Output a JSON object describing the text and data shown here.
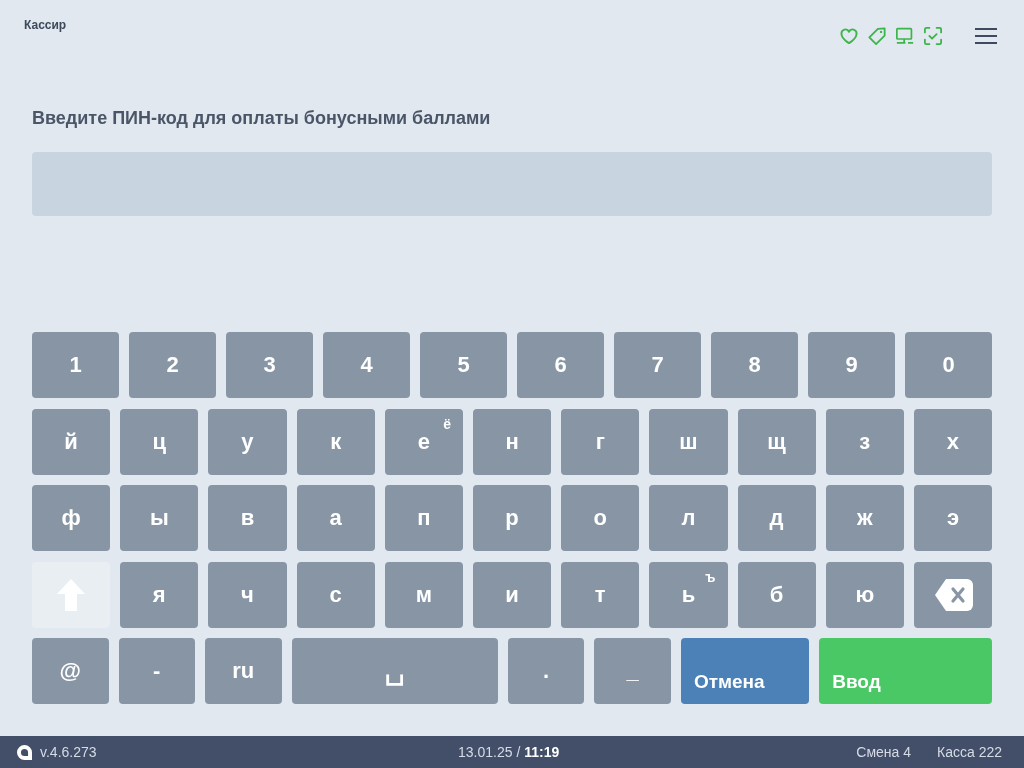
{
  "header": {
    "title": "Кассир"
  },
  "prompt": "Введите ПИН-код для оплаты бонусными баллами",
  "keyboard": {
    "digit_keys": [
      "1",
      "2",
      "3",
      "4",
      "5",
      "6",
      "7",
      "8",
      "9",
      "0"
    ],
    "letter_rows": [
      [
        {
          "kind": "char",
          "label": "й"
        },
        {
          "kind": "char",
          "label": "ц"
        },
        {
          "kind": "char",
          "label": "у"
        },
        {
          "kind": "char",
          "label": "к"
        },
        {
          "kind": "char",
          "label": "е",
          "alt": "ё"
        },
        {
          "kind": "char",
          "label": "н"
        },
        {
          "kind": "char",
          "label": "г"
        },
        {
          "kind": "char",
          "label": "ш"
        },
        {
          "kind": "char",
          "label": "щ"
        },
        {
          "kind": "char",
          "label": "з"
        },
        {
          "kind": "char",
          "label": "х"
        }
      ],
      [
        {
          "kind": "char",
          "label": "ф"
        },
        {
          "kind": "char",
          "label": "ы"
        },
        {
          "kind": "char",
          "label": "в"
        },
        {
          "kind": "char",
          "label": "а"
        },
        {
          "kind": "char",
          "label": "п"
        },
        {
          "kind": "char",
          "label": "р"
        },
        {
          "kind": "char",
          "label": "о"
        },
        {
          "kind": "char",
          "label": "л"
        },
        {
          "kind": "char",
          "label": "д"
        },
        {
          "kind": "char",
          "label": "ж"
        },
        {
          "kind": "char",
          "label": "э"
        }
      ],
      [
        {
          "kind": "shift"
        },
        {
          "kind": "char",
          "label": "я"
        },
        {
          "kind": "char",
          "label": "ч"
        },
        {
          "kind": "char",
          "label": "с"
        },
        {
          "kind": "char",
          "label": "м"
        },
        {
          "kind": "char",
          "label": "и"
        },
        {
          "kind": "char",
          "label": "т"
        },
        {
          "kind": "char",
          "label": "ь",
          "alt": "ъ"
        },
        {
          "kind": "char",
          "label": "б"
        },
        {
          "kind": "char",
          "label": "ю"
        },
        {
          "kind": "backspace"
        }
      ]
    ],
    "bottom_keys": [
      {
        "kind": "char",
        "label": "@"
      },
      {
        "kind": "char",
        "label": "-"
      },
      {
        "kind": "char",
        "label": "ru"
      },
      {
        "kind": "space",
        "label": "␣"
      },
      {
        "kind": "char",
        "label": "."
      },
      {
        "kind": "char",
        "label": "_"
      },
      {
        "kind": "cancel",
        "label": "Отмена"
      },
      {
        "kind": "enter",
        "label": "Ввод"
      }
    ]
  },
  "status_bar": {
    "version": "v.4.6.273",
    "datetime": "13.01.25 / **11:19**",
    "shift": "Смена 4",
    "register": "Касса 222"
  }
}
